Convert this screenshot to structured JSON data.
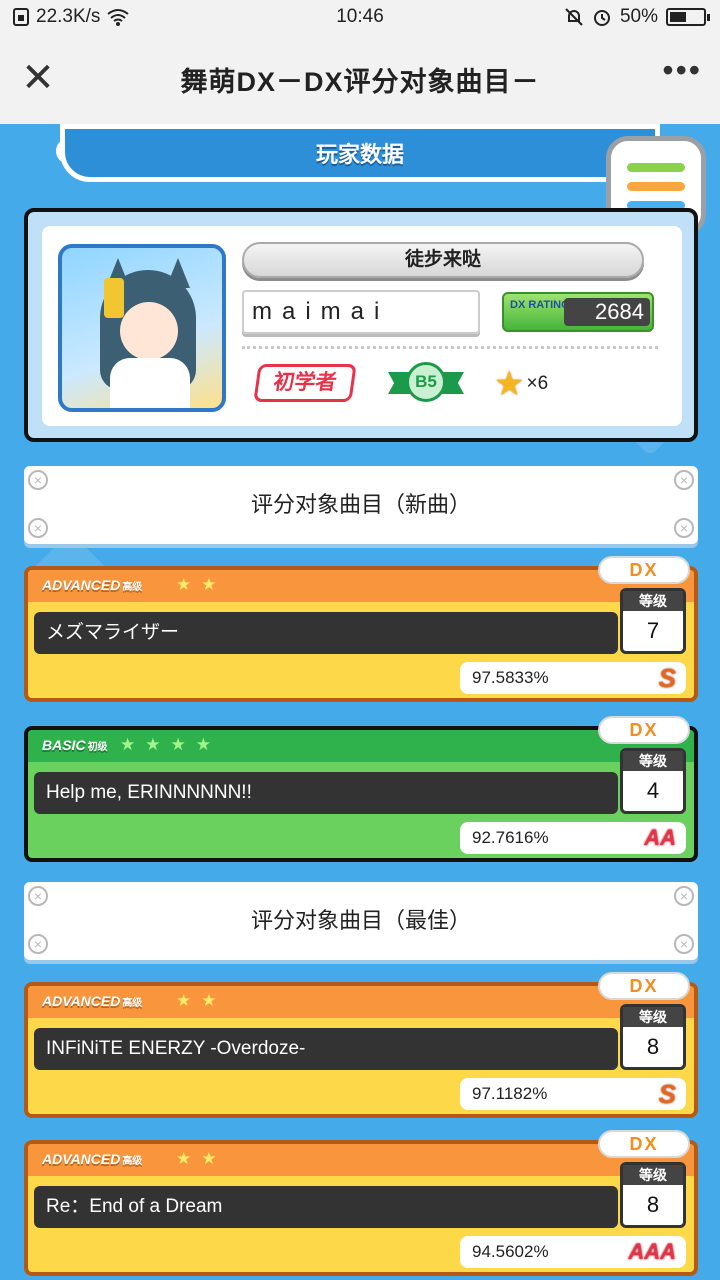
{
  "status_bar": {
    "net_speed": "22.3K/s",
    "time": "10:46",
    "battery": "50%",
    "battery_level": 0.5
  },
  "title_bar": {
    "title": "舞萌DX－DX评分对象曲目－",
    "close_icon": "close-icon",
    "more_icon": "more-icon"
  },
  "banner": {
    "title": "玩家数据"
  },
  "menu_colors": [
    "#8bd14a",
    "#f9a640",
    "#4ab0f0"
  ],
  "player": {
    "title_plate": "徒步来哒",
    "name": "maimai",
    "rating_label": "DX RATING",
    "rating": "2684",
    "class": "初学者",
    "grade": "B5",
    "stars": "×6"
  },
  "sections": {
    "new": "评分对象曲目（新曲）",
    "best": "评分对象曲目（最佳）"
  },
  "level_label": "等级",
  "songs": [
    {
      "difficulty": "ADVANCED",
      "difficulty_sub": "高级",
      "stars": "★★",
      "type": "DX",
      "title": "メズマライザー",
      "level": "7",
      "score": "97.5833%",
      "rank": "S"
    },
    {
      "difficulty": "BASIC",
      "difficulty_sub": "初级",
      "stars": "★★★★",
      "type": "DX",
      "title": "Help me, ERINNNNNN!!",
      "level": "4",
      "score": "92.7616%",
      "rank": "AA"
    },
    {
      "difficulty": "ADVANCED",
      "difficulty_sub": "高级",
      "stars": "★★",
      "type": "DX",
      "title": "INFiNiTE ENERZY -Overdoze-",
      "level": "8",
      "score": "97.1182%",
      "rank": "S"
    },
    {
      "difficulty": "ADVANCED",
      "difficulty_sub": "高级",
      "stars": "★★",
      "type": "DX",
      "title": "Re：End of a Dream",
      "level": "8",
      "score": "94.5602%",
      "rank": "AAA"
    }
  ]
}
